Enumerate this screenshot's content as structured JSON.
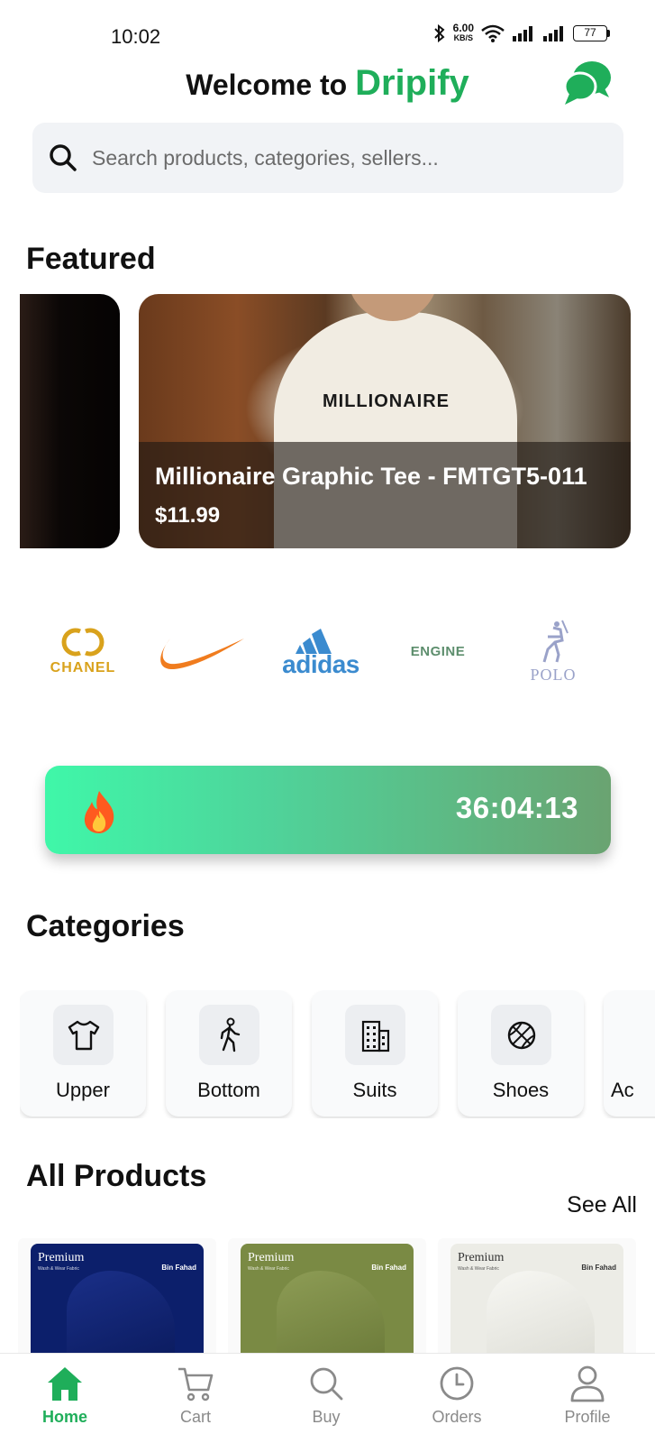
{
  "status_bar": {
    "time": "10:02",
    "net_speed": "6.00",
    "net_unit": "KB/S",
    "battery": "77"
  },
  "header": {
    "welcome": "Welcome to",
    "brand": "Dripify",
    "brand_color": "#1fae5a",
    "chat_icon": "chat-bubbles-icon"
  },
  "search": {
    "placeholder": "Search products, categories, sellers..."
  },
  "featured": {
    "title": "Featured",
    "items": [
      {
        "name": "Millionaire Graphic Tee - FMTGT5-011",
        "price": "$11.99",
        "print": "MILLIONAIRE"
      }
    ]
  },
  "brands": [
    {
      "name": "CHANEL",
      "icon": "chanel-logo"
    },
    {
      "name": "Nike",
      "icon": "nike-swoosh-logo"
    },
    {
      "name": "adidas",
      "icon": "adidas-logo"
    },
    {
      "name": "ENGINE",
      "icon": "engine-logo"
    },
    {
      "name": "POLO",
      "icon": "polo-logo"
    }
  ],
  "deal": {
    "icon": "fire-icon",
    "timer": "36:04:13"
  },
  "categories": {
    "title": "Categories",
    "items": [
      {
        "label": "Upper",
        "icon": "tshirt-icon"
      },
      {
        "label": "Bottom",
        "icon": "walking-person-icon"
      },
      {
        "label": "Suits",
        "icon": "building-icon"
      },
      {
        "label": "Shoes",
        "icon": "basketball-icon"
      },
      {
        "label": "Ac",
        "icon": "accessories-icon"
      }
    ]
  },
  "products": {
    "title": "All Products",
    "see_all": "See All",
    "items": [
      {
        "label": "Premium",
        "sub": "Wash & Wear Fabric",
        "brand": "Bin Fahad",
        "color": "#0c1f6b"
      },
      {
        "label": "Premium",
        "sub": "Wash & Wear Fabric",
        "brand": "Bin Fahad",
        "color": "#7a8a44"
      },
      {
        "label": "Premium",
        "sub": "Wash & Wear Fabric",
        "brand": "Bin Fahad",
        "color": "#ecece6"
      }
    ]
  },
  "nav": {
    "items": [
      {
        "label": "Home",
        "icon": "home-icon",
        "active": true
      },
      {
        "label": "Cart",
        "icon": "cart-icon"
      },
      {
        "label": "Buy",
        "icon": "search-icon"
      },
      {
        "label": "Orders",
        "icon": "clock-icon"
      },
      {
        "label": "Profile",
        "icon": "person-icon"
      }
    ],
    "active_color": "#1fae5a",
    "inactive_color": "#8a8a8a"
  }
}
